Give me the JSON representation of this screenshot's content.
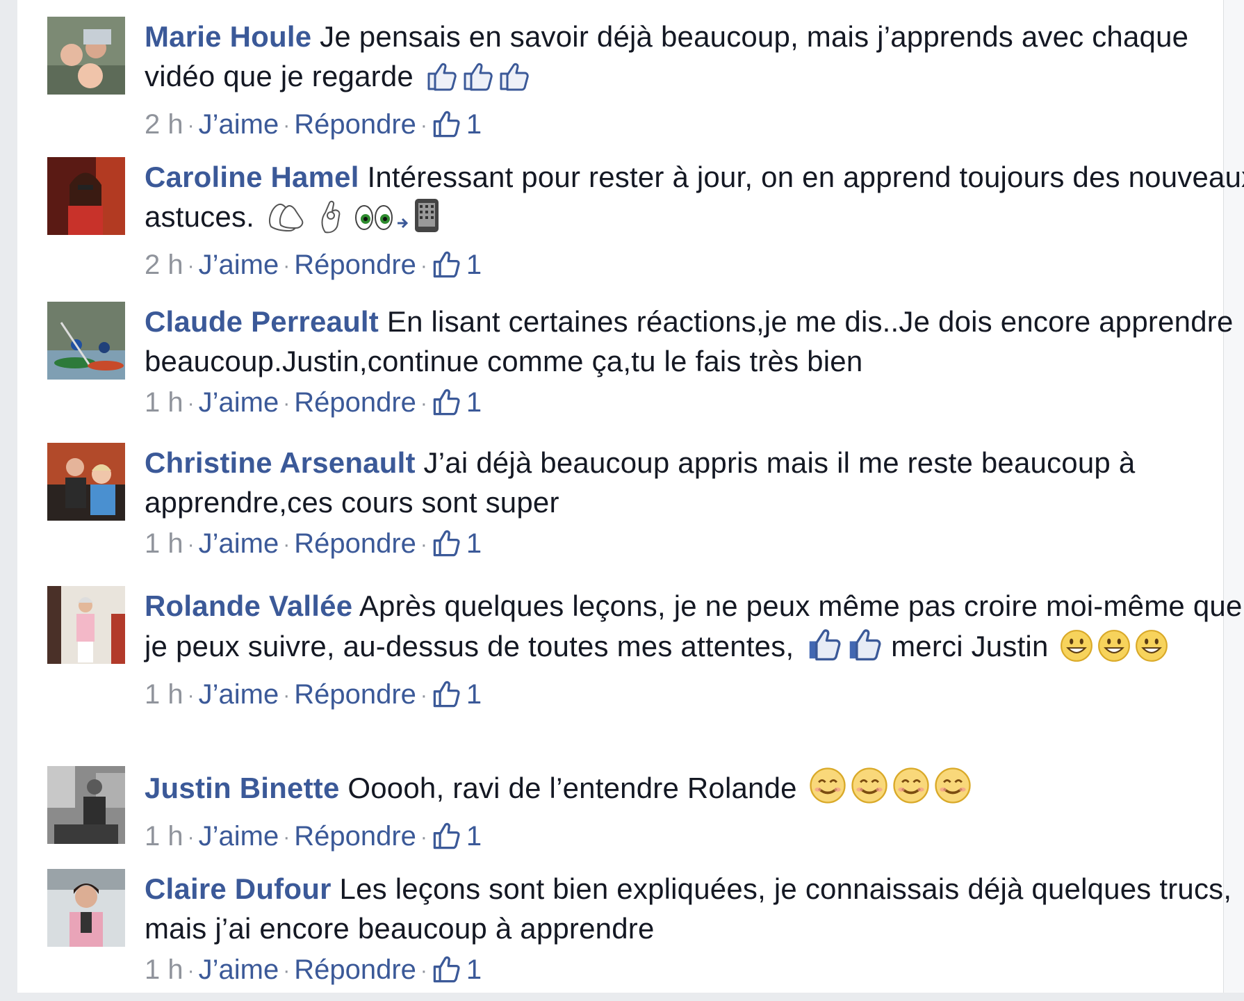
{
  "comments": [
    {
      "author": "Marie Houle",
      "text": "Je pensais en savoir déjà beaucoup, mais j’apprends avec chaque vidéo que je regarde",
      "emojis": [
        "thumbs-up-outline",
        "thumbs-up-outline",
        "thumbs-up-outline"
      ],
      "time": "2 h",
      "like_label": "J’aime",
      "reply_label": "Répondre",
      "likes": "1"
    },
    {
      "author": "Caroline Hamel",
      "text": "Intéressant pour rester à jour, on en apprend toujours des nouveaux astuces.",
      "emojis": [
        "clapping-hands",
        "ok-hand",
        "eyes",
        "arrow-right",
        "tablet"
      ],
      "time": "2 h",
      "like_label": "J’aime",
      "reply_label": "Répondre",
      "likes": "1"
    },
    {
      "author": "Claude Perreault",
      "text": "En lisant certaines réactions,je me dis..Je dois encore apprendre beaucoup.Justin,continue comme ça,tu le fais très bien",
      "emojis": [],
      "time": "1 h",
      "like_label": "J’aime",
      "reply_label": "Répondre",
      "likes": "1"
    },
    {
      "author": "Christine Arsenault",
      "text": "J’ai déjà beaucoup appris mais il me reste beaucoup à apprendre,ces cours sont super",
      "emojis": [],
      "time": "1 h",
      "like_label": "J’aime",
      "reply_label": "Répondre",
      "likes": "1"
    },
    {
      "author": "Rolande Vallée",
      "text": "Après quelques leçons, je ne peux même pas croire moi-même que je peux suivre, au-dessus de toutes mes attentes,",
      "text_after": "merci Justin",
      "emojis_mid": [
        "thumbs-up",
        "thumbs-up"
      ],
      "emojis": [
        "grinning-face",
        "grinning-face",
        "grinning-face"
      ],
      "time": "1 h",
      "like_label": "J’aime",
      "reply_label": "Répondre",
      "likes": "1"
    },
    {
      "author": "Justin Binette",
      "text": "Ooooh, ravi de l’entendre Rolande",
      "emojis": [
        "smiling-face",
        "smiling-face",
        "smiling-face",
        "smiling-face"
      ],
      "time": "1 h",
      "like_label": "J’aime",
      "reply_label": "Répondre",
      "likes": "1"
    },
    {
      "author": "Claire Dufour",
      "text": "Les leçons sont bien expliquées, je connaissais déjà quelques trucs, mais j’ai encore beaucoup à apprendre",
      "emojis": [],
      "time": "1 h",
      "like_label": "J’aime",
      "reply_label": "Répondre",
      "likes": "1"
    }
  ],
  "colors": {
    "author": "#3b5998",
    "text": "#141823",
    "meta": "#90949c",
    "background": "#ffffff",
    "page": "#e9ebee"
  }
}
